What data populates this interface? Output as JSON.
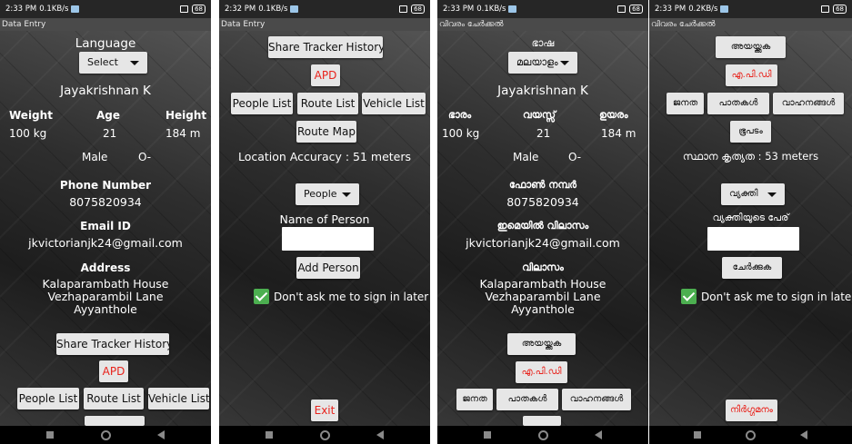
{
  "screens": [
    {
      "status": {
        "time": "2:33 PM",
        "speed": "0.1KB/s",
        "battery": "68"
      },
      "title": "Data Entry",
      "language_label": "Language",
      "language_select": "Select",
      "name": "Jayakrishnan K",
      "stats_labels": [
        "Weight",
        "Age",
        "Height"
      ],
      "stats_values": [
        "100 kg",
        "21",
        "184 m"
      ],
      "gender": "Male",
      "blood": "O-",
      "phone_label": "Phone Number",
      "phone": "8075820934",
      "email_label": "Email ID",
      "email": "jkvictorianjk24@gmail.com",
      "address_label": "Address",
      "address_lines": [
        "Kalaparambath House",
        "Vezhaparambil Lane",
        "Ayyanthole"
      ],
      "share_button": "Share Tracker History",
      "apd_button": "APD",
      "list_buttons": [
        "People List",
        "Route List",
        "Vehicle List"
      ]
    },
    {
      "status": {
        "time": "2:32 PM",
        "speed": "0.1KB/s",
        "battery": "68"
      },
      "title": "Data Entry",
      "share_button": "Share Tracker History",
      "apd_button": "APD",
      "list_buttons": [
        "People List",
        "Route List",
        "Vehicle List"
      ],
      "route_map_button": "Route Map",
      "accuracy": "Location Accuracy :  51 meters",
      "type_select": "People",
      "person_label": "Name of Person",
      "person_input": "",
      "add_button": "Add Person",
      "checkbox_label": "Don't ask me to sign in later",
      "exit_button": "Exit"
    },
    {
      "status": {
        "time": "2:33 PM",
        "speed": "0.1KB/s",
        "battery": "68"
      },
      "title": "വിവരം ചേർക്കൽ",
      "language_label": "ഭാഷ",
      "language_select": "മലയാളം",
      "name": "Jayakrishnan K",
      "stats_labels": [
        "ഭാരം",
        "വയസ്സ്",
        "ഉയരം"
      ],
      "stats_values": [
        "100 kg",
        "21",
        "184 m"
      ],
      "gender": "Male",
      "blood": "O-",
      "phone_label": "ഫോൺ നമ്പർ",
      "phone": "8075820934",
      "email_label": "ഇമെയിൽ വിലാസം",
      "email": "jkvictorianjk24@gmail.com",
      "address_label": "വിലാസം",
      "address_lines": [
        "Kalaparambath House",
        "Vezhaparambil Lane",
        "Ayyanthole"
      ],
      "share_button": "അയയ്ക്കുക",
      "apd_button": "എ.പി.ഡി",
      "list_buttons": [
        "ജനത",
        "പാതകൾ",
        "വാഹനങ്ങൾ"
      ]
    },
    {
      "status": {
        "time": "2:33 PM",
        "speed": "0.2KB/s",
        "battery": "68"
      },
      "title": "വിവരം ചേർക്കൽ",
      "share_button": "അയയ്ക്കുക",
      "apd_button": "എ.പി.ഡി",
      "list_buttons": [
        "ജനത",
        "പാതകൾ",
        "വാഹനങ്ങൾ"
      ],
      "route_map_button": "ഭൂപടം",
      "accuracy": "സ്ഥാന കൃത്യത :  53 meters",
      "type_select": "വ്യക്തി",
      "person_label": "വ്യക്തിയുടെ പേര്",
      "person_input": "",
      "add_button": "ചേർക്കുക",
      "checkbox_label": "Don't ask me to sign in later",
      "exit_button": "നിർഗ്ഗമനം"
    }
  ]
}
